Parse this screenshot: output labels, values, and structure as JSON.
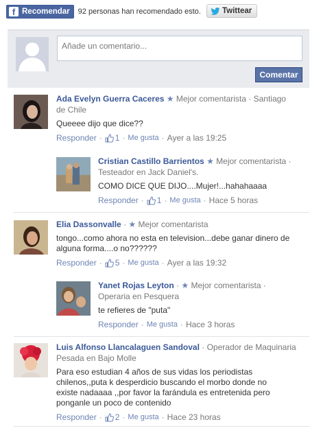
{
  "share": {
    "facebook_label": "Recomendar",
    "facebook_count_text": "92 personas han recomendado esto.",
    "twitter_label": "Twittear"
  },
  "composer": {
    "placeholder": "Añade un comentario...",
    "submit_label": "Comentar"
  },
  "labels": {
    "reply": "Responder",
    "like": "Me gusta",
    "separator": "·",
    "star_glyph": "★"
  },
  "comments": [
    {
      "name": "Ada Evelyn Guerra Caceres",
      "badge": "Mejor comentarista",
      "meta_line1": "· Santiago",
      "meta_line2": "de Chile",
      "text": "Queeee dijo que dice??",
      "likes": "1",
      "time": "Ayer a las 19:25"
    },
    {
      "name": "Cristian Castillo Barrientos",
      "badge": "Mejor comentarista",
      "meta_line1": "·",
      "meta_line2": "Testeador en Jack Daniel's.",
      "text": "COMO DICE QUE DIJO....Mujer!...hahahaaaa",
      "likes": "1",
      "time": "Hace 5 horas"
    },
    {
      "name": "Elia Dassonvalle",
      "badge": "Mejor comentarista",
      "text": "tongo...como ahora no esta en television...debe ganar dinero de alguna forma....o no??????",
      "likes": "5",
      "time": "Ayer a las 19:32"
    },
    {
      "name": "Yanet Rojas Leyton",
      "badge": "Mejor comentarista",
      "meta_line1": "·",
      "meta_line2": "Operaria en Pesquera",
      "text": "te refieres de \"puta\"",
      "time": "Hace 3 horas"
    },
    {
      "name": "Luis Alfonso Llancalaguen Sandoval",
      "meta_line1": "· Operador de Maquinaria",
      "meta_line2": "Pesada en Bajo Molle",
      "text": "Para eso estudian 4 años de sus vidas los periodistas chilenos,,puta k desperdicio buscando el morbo donde no existe nadaaaa ,,por favor la farándula es entretenida pero ponganle un poco de contenido",
      "likes": "2",
      "time": "Hace 23 horas"
    }
  ],
  "colors": {
    "link": "#3b5998",
    "facebook_blue": "#4a66a0",
    "composer_bg": "#e9ebee",
    "button": "#5b74a8"
  }
}
